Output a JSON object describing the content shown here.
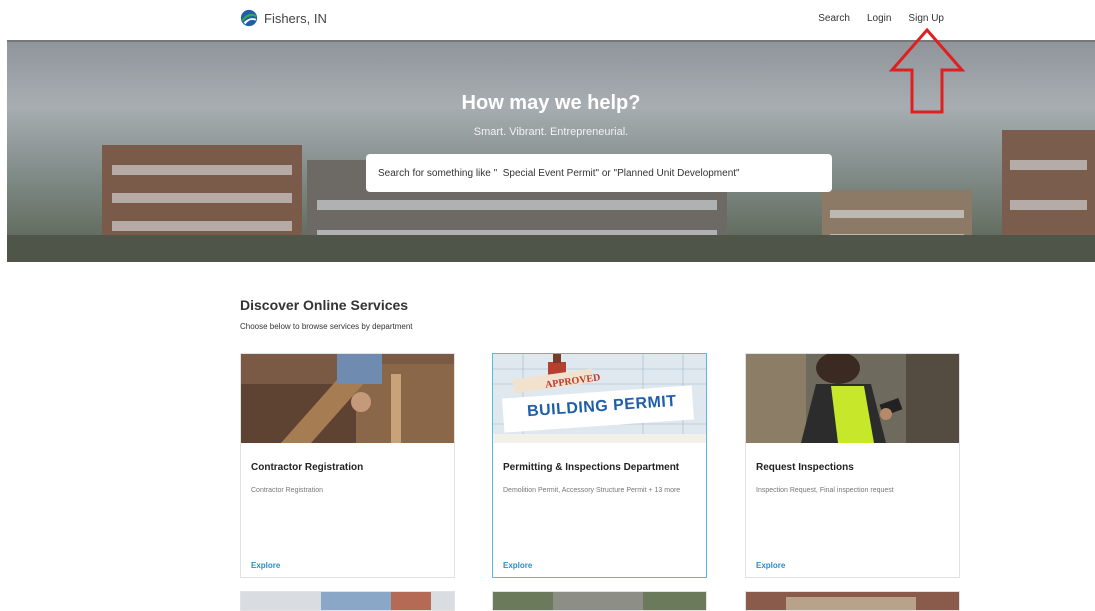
{
  "nav": {
    "brand_name": "Fishers, IN",
    "links": [
      "Search",
      "Login",
      "Sign Up"
    ]
  },
  "hero": {
    "title": "How may we help?",
    "subtitle": "Smart. Vibrant. Entrepreneurial.",
    "search_placeholder": "Search for something like \"  Special Event Permit\" or \"Planned Unit Development\""
  },
  "discover": {
    "title": "Discover Online Services",
    "subtitle": "Choose below to browse services by department"
  },
  "cards": [
    {
      "title": "Contractor Registration",
      "description": "Contractor Registration",
      "action": "Explore"
    },
    {
      "title": "Permitting & Inspections Department",
      "description": "Demolition Permit, Accessory Structure Permit + 13 more",
      "action": "Explore",
      "image_text": [
        "APPROVED",
        "BUILDING PERMIT"
      ]
    },
    {
      "title": "Request Inspections",
      "description": "Inspection Request, Final inspection request",
      "action": "Explore"
    }
  ],
  "colors": {
    "accent": "#2a8fc9",
    "selected_border": "#5ab9d6",
    "annotation_arrow": "#e02020",
    "brand_green": "#3aa655",
    "brand_blue": "#1f5fa8"
  },
  "icons": {
    "brand": "fishers-logo-icon",
    "annotation": "red-up-arrow-annotation"
  }
}
